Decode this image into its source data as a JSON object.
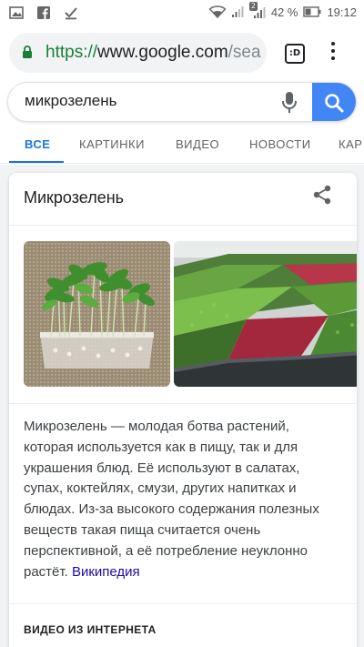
{
  "status_bar": {
    "battery": "42 %",
    "time": "19:12",
    "sim_badge": "2"
  },
  "browser": {
    "url_scheme": "https://",
    "url_host": "www.google.com",
    "url_path": "/sea",
    "tabs_button_label": ":D"
  },
  "search": {
    "query": "микрозелень"
  },
  "tabs": [
    {
      "label": "ВСЕ"
    },
    {
      "label": "КАРТИНКИ"
    },
    {
      "label": "ВИДЕО"
    },
    {
      "label": "НОВОСТИ"
    },
    {
      "label": "КАР"
    }
  ],
  "knowledge_card": {
    "title": "Микрозелень",
    "description": "Микрозелень — молодая ботва растений, которая используется как в пищу, так и для украшения блюд. Её используют в салатах, супах, коктейлях, смузи, других напитках и блюдах. Из-за высокого содержания полезных веществ такая пища считается очень перспективной, а её потребление неуклонно растёт.",
    "source_link": "Википедия",
    "section_title": "ВИДЕО ИЗ ИНТЕРНЕТА"
  },
  "colors": {
    "accent": "#1a73e8",
    "search_button": "#4285f4",
    "secure_green": "#188038",
    "link": "#1a0dab"
  }
}
